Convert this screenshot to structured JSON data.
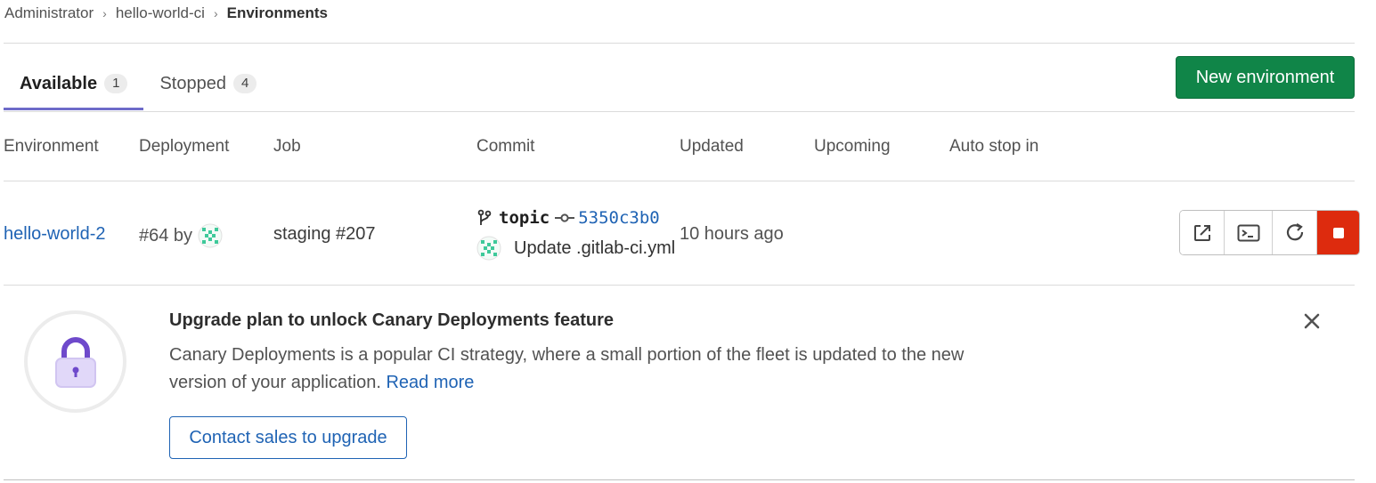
{
  "breadcrumb": {
    "items": [
      "Administrator",
      "hello-world-ci"
    ],
    "current": "Environments",
    "separator": "›"
  },
  "tabs": [
    {
      "label": "Available",
      "count": "1",
      "active": true
    },
    {
      "label": "Stopped",
      "count": "4",
      "active": false
    }
  ],
  "actions": {
    "new_environment": "New environment"
  },
  "table": {
    "headers": [
      "Environment",
      "Deployment",
      "Job",
      "Commit",
      "Updated",
      "Upcoming",
      "Auto stop in"
    ],
    "rows": [
      {
        "environment": "hello-world-2",
        "deployment": "#64 by",
        "job": "staging #207",
        "commit": {
          "ref": "topic",
          "sha": "5350c3b0",
          "message": "Update .gitlab-ci.yml"
        },
        "updated": "10 hours ago",
        "row_actions": [
          "external-link-icon",
          "terminal-icon",
          "retry-icon",
          "stop-icon"
        ]
      }
    ]
  },
  "upgrade": {
    "title": "Upgrade plan to unlock Canary Deployments feature",
    "text": "Canary Deployments is a popular CI strategy, where a small portion of the fleet is updated to the new version of your application.",
    "link": "Read more",
    "button": "Contact sales to upgrade"
  },
  "colors": {
    "primary_green": "#108548",
    "link_blue": "#1f63b4",
    "danger_red": "#dd2b0e",
    "tab_underline": "#6e6bc9",
    "lock_purple": "#6e49cb"
  }
}
